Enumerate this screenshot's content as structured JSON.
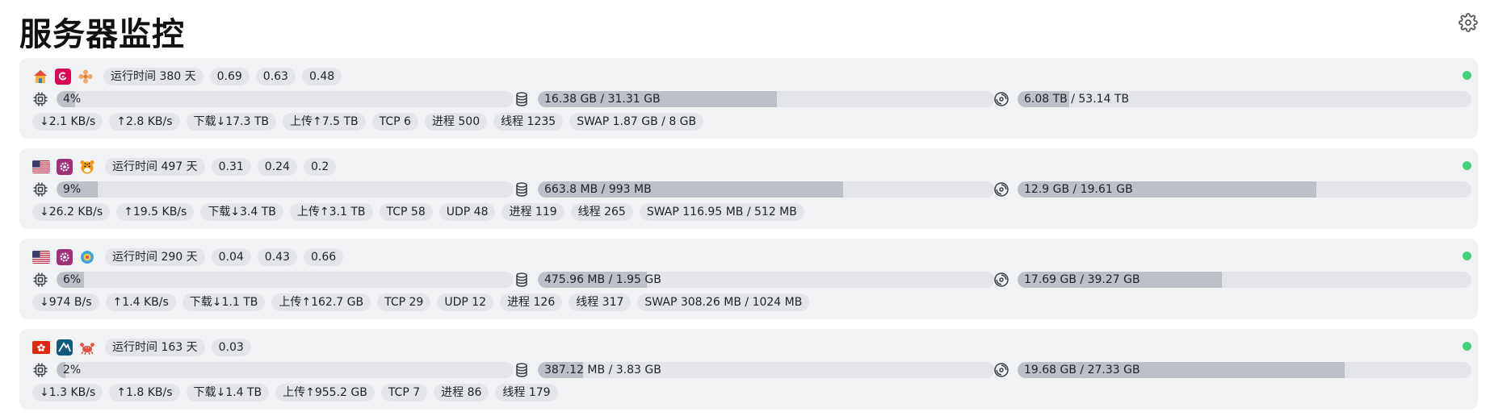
{
  "page": {
    "title": "服务器监控"
  },
  "colors": {
    "online": "#3ed27a",
    "bar_fill": "#bcc1c8",
    "bar_track": "#e3e5e8"
  },
  "servers": [
    {
      "icons": [
        "home-icon",
        "debian-icon",
        "flower-icon"
      ],
      "uptime": "运行时间 380 天",
      "loads": [
        "0.69",
        "0.63",
        "0.48"
      ],
      "cpu": {
        "label": "4%",
        "fraction": 0.04
      },
      "mem": {
        "label": "16.38 GB / 31.31 GB",
        "fraction": 0.523
      },
      "disk": {
        "label": "6.08 TB / 53.14 TB",
        "fraction": 0.114
      },
      "stats": [
        "↓2.1 KB/s",
        "↑2.8 KB/s",
        "下载↓17.3 TB",
        "上传↑7.5 TB",
        "TCP 6",
        "进程 500",
        "线程 1235",
        "SWAP 1.87 GB / 8 GB"
      ]
    },
    {
      "icons": [
        "us-flag-icon",
        "settings-app-icon",
        "tiger-icon"
      ],
      "uptime": "运行时间 497 天",
      "loads": [
        "0.31",
        "0.24",
        "0.2"
      ],
      "cpu": {
        "label": "9%",
        "fraction": 0.09
      },
      "mem": {
        "label": "663.8 MB / 993 MB",
        "fraction": 0.668
      },
      "disk": {
        "label": "12.9 GB / 19.61 GB",
        "fraction": 0.658
      },
      "stats": [
        "↓26.2 KB/s",
        "↑19.5 KB/s",
        "下载↓3.4 TB",
        "上传↑3.1 TB",
        "TCP 58",
        "UDP 48",
        "进程 119",
        "线程 265",
        "SWAP 116.95 MB / 512 MB"
      ]
    },
    {
      "icons": [
        "us-flag-icon",
        "settings-app-icon",
        "sphere-icon"
      ],
      "uptime": "运行时间 290 天",
      "loads": [
        "0.04",
        "0.43",
        "0.66"
      ],
      "cpu": {
        "label": "6%",
        "fraction": 0.06
      },
      "mem": {
        "label": "475.96 MB / 1.95 GB",
        "fraction": 0.238
      },
      "disk": {
        "label": "17.69 GB / 39.27 GB",
        "fraction": 0.45
      },
      "stats": [
        "↓974 B/s",
        "↑1.4 KB/s",
        "下载↓1.1 TB",
        "上传↑162.7 GB",
        "TCP 29",
        "UDP 12",
        "进程 126",
        "线程 317",
        "SWAP 308.26 MB / 1024 MB"
      ]
    },
    {
      "icons": [
        "hk-flag-icon",
        "alpine-icon",
        "crab-icon"
      ],
      "uptime": "运行时间 163 天",
      "loads": [
        "0.03"
      ],
      "cpu": {
        "label": "2%",
        "fraction": 0.02
      },
      "mem": {
        "label": "387.12 MB / 3.83 GB",
        "fraction": 0.099
      },
      "disk": {
        "label": "19.68 GB / 27.33 GB",
        "fraction": 0.72
      },
      "stats": [
        "↓1.3 KB/s",
        "↑1.8 KB/s",
        "下载↓1.4 TB",
        "上传↑955.2 GB",
        "TCP 7",
        "进程 86",
        "线程 179"
      ]
    }
  ]
}
